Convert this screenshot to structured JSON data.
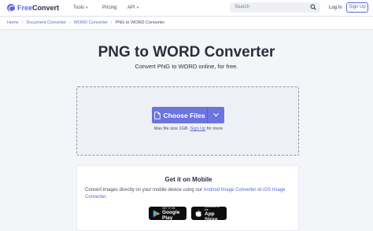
{
  "header": {
    "logo": {
      "part1": "Free",
      "part2": "Convert"
    },
    "nav": [
      {
        "label": "Tools",
        "has_dropdown": true
      },
      {
        "label": "Pricing",
        "has_dropdown": false
      },
      {
        "label": "API",
        "has_dropdown": true
      }
    ],
    "search": {
      "placeholder": "Search",
      "icon": "search-icon"
    },
    "login_label": "Log In",
    "signup_label": "Sign Up"
  },
  "breadcrumb": [
    {
      "label": "Home"
    },
    {
      "label": "Document Converter"
    },
    {
      "label": "WORD Converter"
    },
    {
      "label": "PNG to WORD Converter"
    }
  ],
  "main": {
    "title": "PNG to WORD Converter",
    "subtitle": "Convert PNG to WORD online, for free."
  },
  "upload": {
    "button_label": "Choose Files",
    "button_icon": "file-icon",
    "dropdown_icon": "chevron-down-icon",
    "note_prefix": "Max file size 1GB.",
    "note_link": "Sign Up",
    "note_suffix": "for more"
  },
  "mobile": {
    "title": "Get it on Mobile",
    "text_prefix": "Convert images directly on your mobile device using our",
    "android_link": "Android Image Converter",
    "text_or": "or",
    "ios_link": "iOS Image Converter",
    "text_end": ".",
    "google_play": {
      "small": "GET IT ON",
      "big": "Google Play"
    },
    "app_store": {
      "small": "Download on the",
      "big": "App Store"
    }
  },
  "colors": {
    "accent": "#5b67d8",
    "button": "#6c74dd",
    "page_bg": "#f4f5f8",
    "dropzone_bg": "#eef0f5"
  }
}
